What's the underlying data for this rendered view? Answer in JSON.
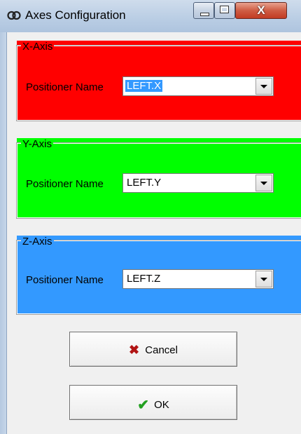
{
  "window": {
    "title": "Axes Configuration",
    "close_glyph": "X"
  },
  "colors": {
    "x_axis": "#ff0000",
    "y_axis": "#00ff00",
    "z_axis": "#3399ff"
  },
  "x_axis": {
    "legend": "X-Axis",
    "label": "Positioner Name",
    "value": "LEFT.X"
  },
  "y_axis": {
    "legend": "Y-Axis",
    "label": "Positioner Name",
    "value": "LEFT.Y"
  },
  "z_axis": {
    "legend": "Z-Axis",
    "label": "Positioner Name",
    "value": "LEFT.Z"
  },
  "buttons": {
    "cancel_label": "Cancel",
    "cancel_icon": "cross-icon",
    "ok_label": "OK",
    "ok_icon": "checkmark-icon"
  }
}
